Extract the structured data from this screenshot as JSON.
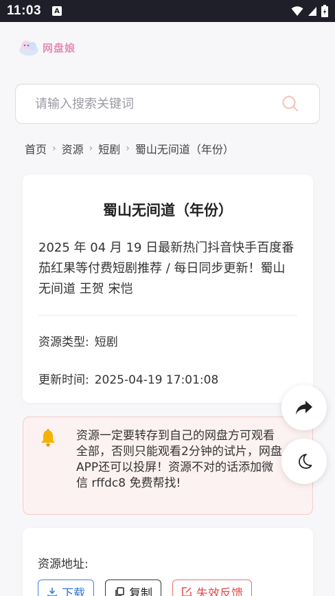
{
  "status_bar": {
    "time": "11:03",
    "notification": "A"
  },
  "header": {
    "logo_text": "网盘娘"
  },
  "search": {
    "placeholder": "请输入搜索关键词"
  },
  "breadcrumb": {
    "items": [
      "首页",
      "资源",
      "短剧",
      "蜀山无间道（年份）"
    ]
  },
  "detail": {
    "title": "蜀山无间道（年份）",
    "description": "2025 年 04 月 19 日最新热门抖音快手百度番茄红果等付费短剧推荐 / 每日同步更新！蜀山无间道 王贺 宋恺",
    "type_label": "资源类型:",
    "type_value": "短剧",
    "updated_label": "更新时间:",
    "updated_value": "2025-04-19 17:01:08"
  },
  "notice": {
    "text": "资源一定要转存到自己的网盘方可观看全部，否则只能观看2分钟的试片，网盘APP还可以投屏！资源不对的话添加微信 rffdc8 免费帮找!"
  },
  "resource": {
    "label": "资源地址:",
    "download_label": "下载",
    "copy_label": "复制",
    "feedback_label": "失效反馈"
  },
  "colors": {
    "accent": "#2a72d6",
    "danger": "#e24c4c",
    "logo": "#e58fb6",
    "notice_bg": "#fdf2f2"
  }
}
